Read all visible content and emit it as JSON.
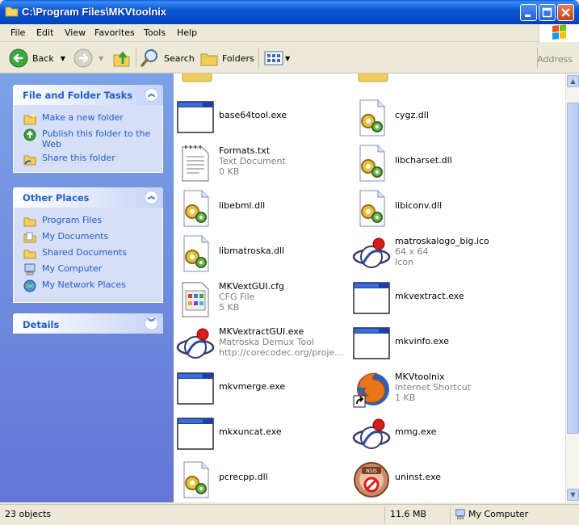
{
  "window": {
    "title": "C:\\Program Files\\MKVtoolnix"
  },
  "menu": [
    "File",
    "Edit",
    "View",
    "Favorites",
    "Tools",
    "Help"
  ],
  "toolbar": {
    "back_label": "Back",
    "search_label": "Search",
    "folders_label": "Folders",
    "address_label": "Address"
  },
  "tasks": {
    "title": "File and Folder Tasks",
    "items": [
      {
        "label": "Make a new folder",
        "icon": "new-folder-icon"
      },
      {
        "label": "Publish this folder to the Web",
        "icon": "publish-web-icon"
      },
      {
        "label": "Share this folder",
        "icon": "share-folder-icon"
      }
    ]
  },
  "other_places": {
    "title": "Other Places",
    "items": [
      {
        "label": "Program Files",
        "icon": "folder-icon"
      },
      {
        "label": "My Documents",
        "icon": "my-documents-icon"
      },
      {
        "label": "Shared Documents",
        "icon": "shared-documents-icon"
      },
      {
        "label": "My Computer",
        "icon": "my-computer-icon"
      },
      {
        "label": "My Network Places",
        "icon": "network-places-icon"
      }
    ]
  },
  "details": {
    "title": "Details"
  },
  "files": [
    {
      "name": "base64tool.exe",
      "icon": "exe-window-icon"
    },
    {
      "name": "cygz.dll",
      "icon": "dll-gear-icon"
    },
    {
      "name": "Formats.txt",
      "sub1": "Text Document",
      "sub2": "0 KB",
      "icon": "text-document-icon"
    },
    {
      "name": "libcharset.dll",
      "icon": "dll-gear-icon"
    },
    {
      "name": "libebml.dll",
      "icon": "dll-gear-icon"
    },
    {
      "name": "libiconv.dll",
      "icon": "dll-gear-icon"
    },
    {
      "name": "libmatroska.dll",
      "icon": "dll-gear-icon"
    },
    {
      "name": "matroskalogo_big.ico",
      "sub1": "64 x 64",
      "sub2": "Icon",
      "icon": "matroska-logo-icon"
    },
    {
      "name": "MKVextGUI.cfg",
      "sub1": "CFG File",
      "sub2": "5 KB",
      "icon": "cfg-file-icon"
    },
    {
      "name": "mkvextract.exe",
      "icon": "exe-window-icon"
    },
    {
      "name": "MKVextractGUI.exe",
      "sub1": "Matroska Demux Tool",
      "sub2": "http://corecodec.org/projects...",
      "icon": "matroska-logo-icon"
    },
    {
      "name": "mkvinfo.exe",
      "icon": "exe-window-icon"
    },
    {
      "name": "mkvmerge.exe",
      "icon": "exe-window-icon"
    },
    {
      "name": "MKVtoolnix",
      "sub1": "Internet Shortcut",
      "sub2": "1 KB",
      "icon": "firefox-shortcut-icon"
    },
    {
      "name": "mkxuncat.exe",
      "icon": "exe-window-icon"
    },
    {
      "name": "mmg.exe",
      "icon": "matroska-logo-icon"
    },
    {
      "name": "pcrecpp.dll",
      "icon": "dll-gear-icon"
    },
    {
      "name": "uninst.exe",
      "icon": "nsis-uninstall-icon"
    }
  ],
  "status": {
    "objects": "23 objects",
    "size": "11.6 MB",
    "location": "My Computer"
  }
}
